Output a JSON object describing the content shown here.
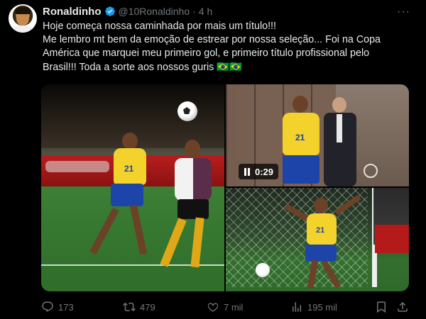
{
  "tweet": {
    "author": {
      "display_name": "Ronaldinho",
      "handle": "@10Ronaldinho",
      "separator": "·",
      "time": "4 h",
      "verified_icon": "verified-badge-icon",
      "accent": "#1d9bf0"
    },
    "text_lines": [
      "Hoje começa nossa caminhada por mais um título!!!",
      "Me lembro mt bem da emoção de estrear por nossa seleção... Foi na Copa",
      "América que marquei meu primeiro gol, e primeiro título profissional pelo",
      "Brasil!!! Toda a sorte aos nossos guris 🇧🇷🇧🇷"
    ],
    "media": {
      "video_duration": "0:29",
      "jersey_number": "21",
      "jersey_numbers_other": [
        "21",
        "21"
      ]
    },
    "actions": {
      "replies": "173",
      "retweets": "479",
      "likes": "7 mil",
      "views": "195 mil"
    },
    "colors": {
      "background": "#000000",
      "text": "#e7e9ea",
      "muted": "#71767b"
    }
  }
}
